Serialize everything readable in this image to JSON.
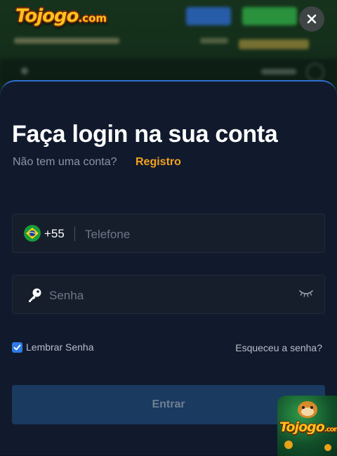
{
  "brand": {
    "logo_text": "Tojogo",
    "logo_suffix": ".com"
  },
  "modal": {
    "title": "Faça login na sua conta",
    "subtitle": "Não tem uma conta?",
    "register_label": "Registro",
    "phone": {
      "country_code": "+55",
      "flag": "brazil-flag-icon",
      "placeholder": "Telefone",
      "value": ""
    },
    "password": {
      "placeholder": "Senha",
      "value": ""
    },
    "remember": {
      "label": "Lembrar Senha",
      "checked": true
    },
    "forgot_label": "Esqueceu a senha?",
    "submit_label": "Entrar"
  },
  "promo": {
    "text": "Tojogo",
    "suffix": ".com"
  },
  "colors": {
    "modal_bg": "#111a2d",
    "field_bg": "#161e2c",
    "accent_link": "#f3a21f",
    "checkbox": "#2f7ae5",
    "submit_bg": "#1a3a60"
  }
}
